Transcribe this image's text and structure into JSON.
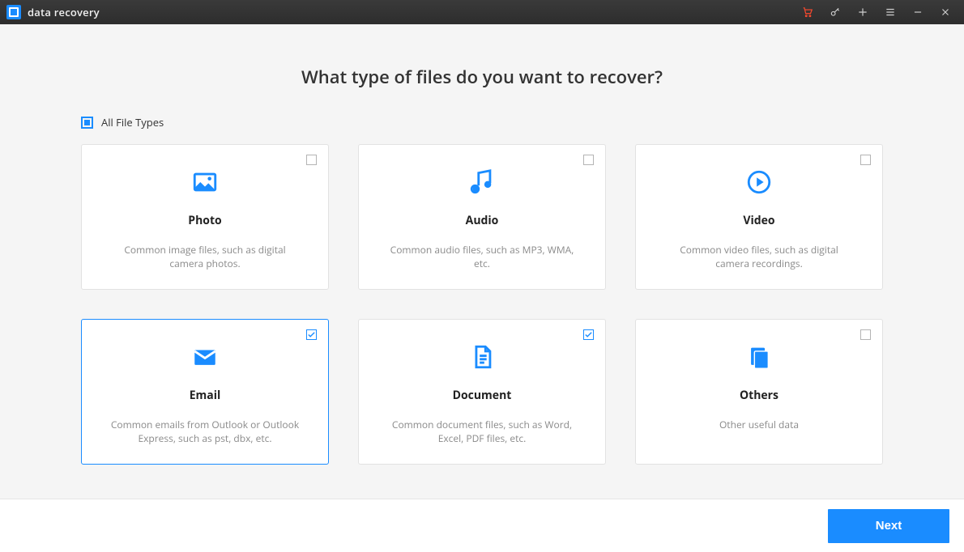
{
  "app": {
    "name": "data recovery"
  },
  "heading": "What type of files do you want to recover?",
  "all_types_label": "All File Types",
  "cards": [
    {
      "key": "photo",
      "title": "Photo",
      "desc": "Common image files, such as digital camera photos.",
      "checked": false,
      "selected": false
    },
    {
      "key": "audio",
      "title": "Audio",
      "desc": "Common audio files, such as MP3, WMA, etc.",
      "checked": false,
      "selected": false
    },
    {
      "key": "video",
      "title": "Video",
      "desc": "Common video files, such as digital camera recordings.",
      "checked": false,
      "selected": false
    },
    {
      "key": "email",
      "title": "Email",
      "desc": "Common emails from Outlook or Outlook Express, such as pst, dbx, etc.",
      "checked": true,
      "selected": true
    },
    {
      "key": "document",
      "title": "Document",
      "desc": "Common document files, such as Word, Excel, PDF files, etc.",
      "checked": true,
      "selected": false
    },
    {
      "key": "others",
      "title": "Others",
      "desc": "Other useful data",
      "checked": false,
      "selected": false
    }
  ],
  "footer": {
    "next_label": "Next"
  },
  "colors": {
    "accent": "#1a8cff",
    "cart": "#ff4a2e"
  }
}
